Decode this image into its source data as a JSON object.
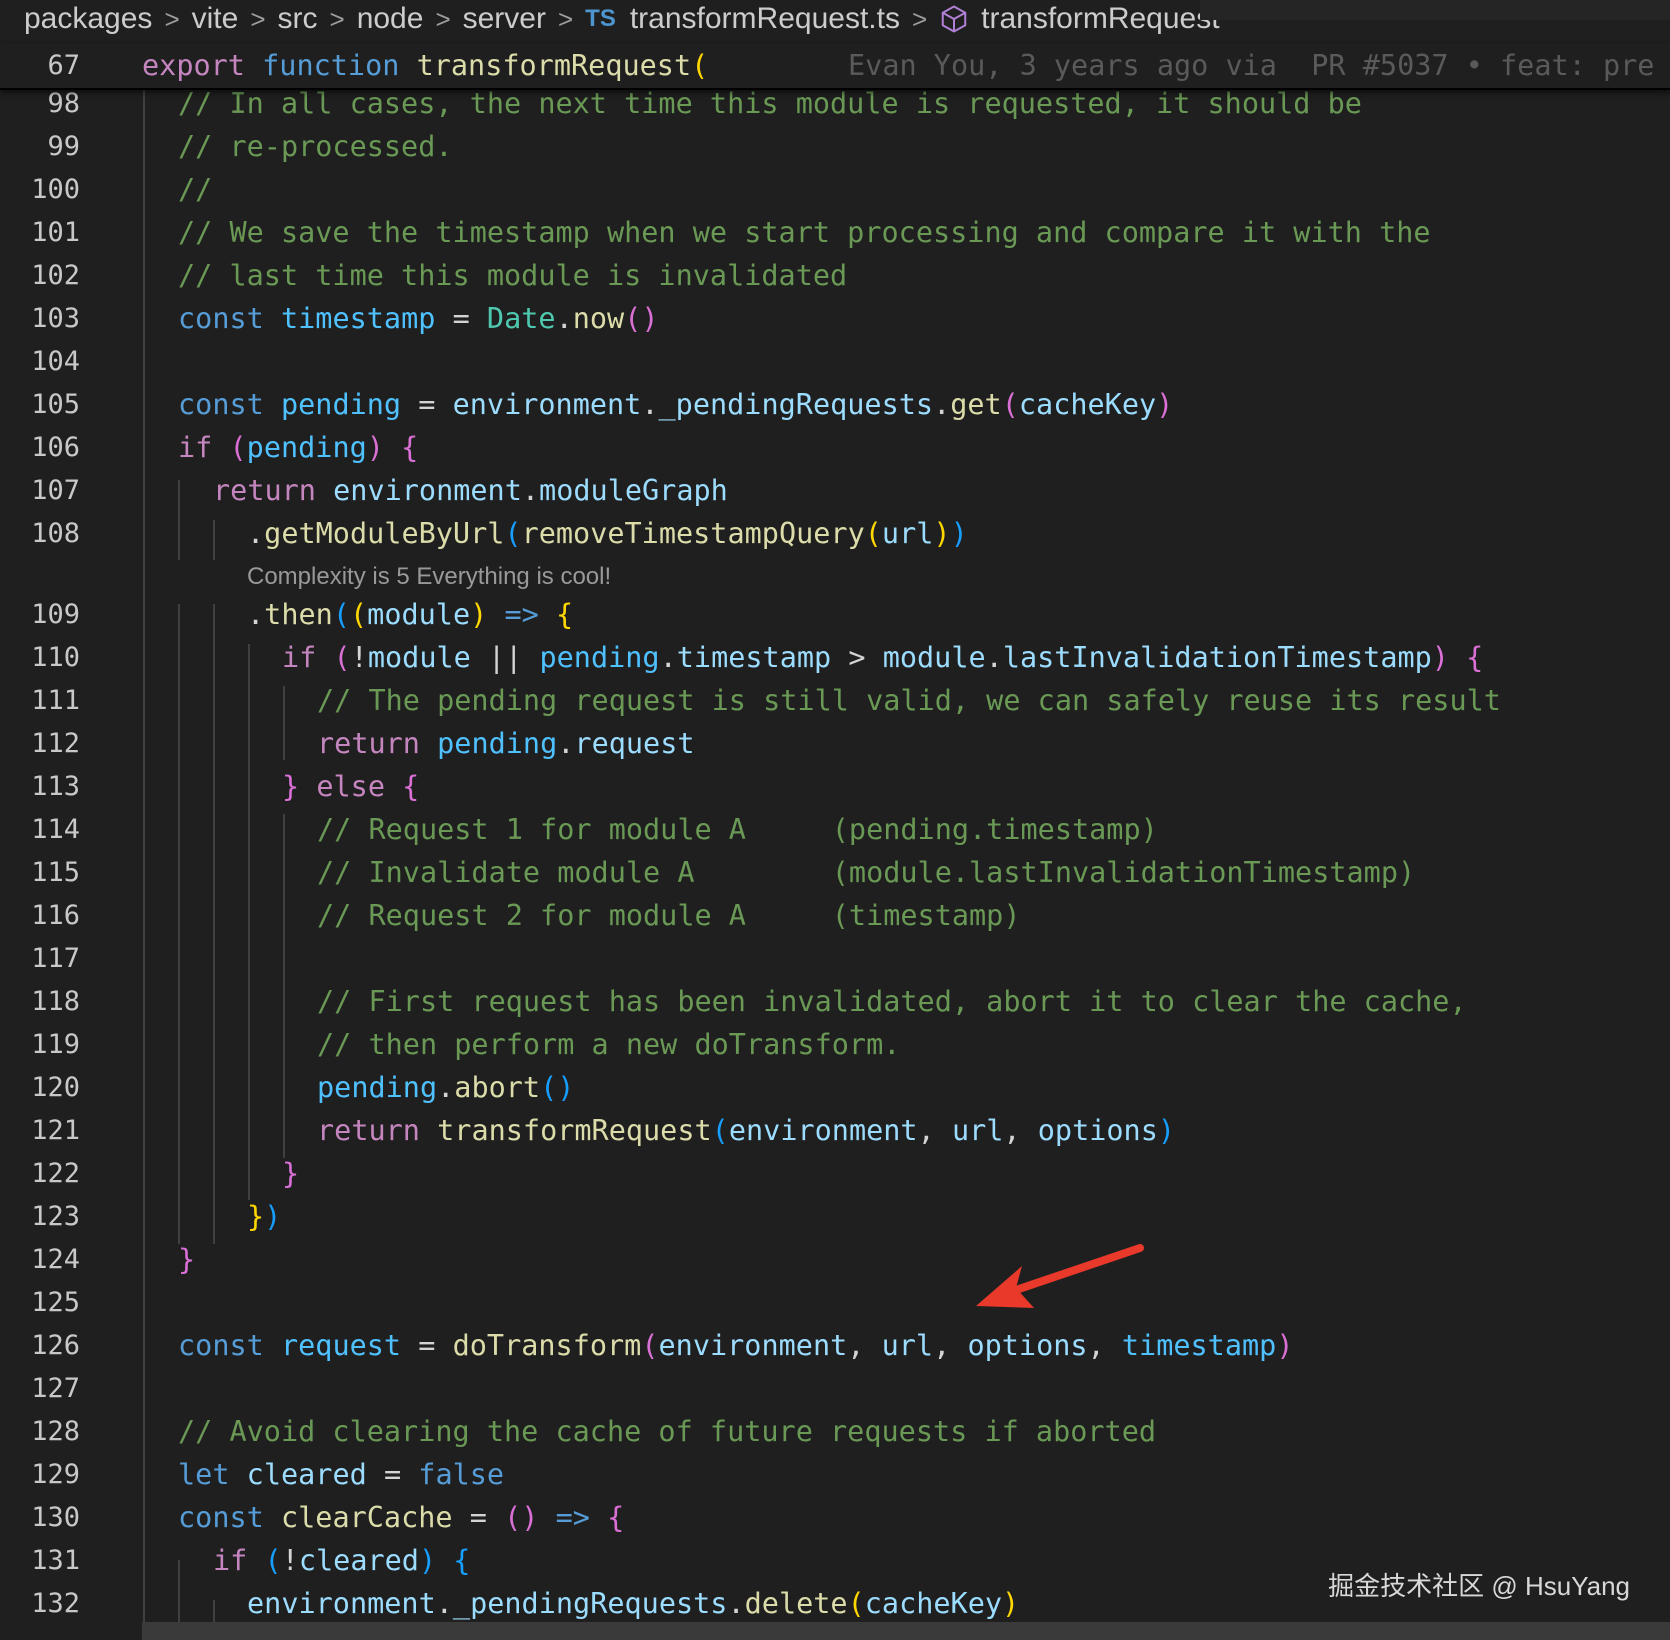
{
  "breadcrumb": {
    "segments": [
      "packages",
      "vite",
      "src",
      "node",
      "server"
    ],
    "file_lang_badge": "TS",
    "file_name": "transformRequest.ts",
    "symbol_name": "transformRequest"
  },
  "sticky": {
    "line_number": "67",
    "code": {
      "export": "export",
      "function": "function",
      "name": "transformRequest",
      "paren": "("
    },
    "blame": "Evan You, 3 years ago via  PR #5037 • feat: pre"
  },
  "code_lens": "Complexity is 5 Everything is cool!",
  "watermark": "掘金技术社区 @ HsuYang",
  "lines": {
    "l98": {
      "n": "98",
      "t": "// In all cases, the next time this module is requested, it should be"
    },
    "l99": {
      "n": "99",
      "t": "// re-processed."
    },
    "l100": {
      "n": "100",
      "t": "//"
    },
    "l101": {
      "n": "101",
      "t": "// We save the timestamp when we start processing and compare it with the"
    },
    "l102": {
      "n": "102",
      "t": "// last time this module is invalidated"
    },
    "l103": {
      "n": "103"
    },
    "l104": {
      "n": "104"
    },
    "l105": {
      "n": "105"
    },
    "l106": {
      "n": "106"
    },
    "l107": {
      "n": "107"
    },
    "l108": {
      "n": "108"
    },
    "l109": {
      "n": "109"
    },
    "l110": {
      "n": "110"
    },
    "l111": {
      "n": "111",
      "t": "// The pending request is still valid, we can safely reuse its result"
    },
    "l112": {
      "n": "112"
    },
    "l113": {
      "n": "113"
    },
    "l114": {
      "n": "114",
      "t": "// Request 1 for module A     (pending.timestamp)"
    },
    "l115": {
      "n": "115",
      "t": "// Invalidate module A        (module.lastInvalidationTimestamp)"
    },
    "l116": {
      "n": "116",
      "t": "// Request 2 for module A     (timestamp)"
    },
    "l117": {
      "n": "117"
    },
    "l118": {
      "n": "118",
      "t": "// First request has been invalidated, abort it to clear the cache,"
    },
    "l119": {
      "n": "119",
      "t": "// then perform a new doTransform."
    },
    "l120": {
      "n": "120"
    },
    "l121": {
      "n": "121"
    },
    "l122": {
      "n": "122"
    },
    "l123": {
      "n": "123"
    },
    "l124": {
      "n": "124"
    },
    "l125": {
      "n": "125"
    },
    "l126": {
      "n": "126"
    },
    "l127": {
      "n": "127"
    },
    "l128": {
      "n": "128",
      "t": "// Avoid clearing the cache of future requests if aborted"
    },
    "l129": {
      "n": "129"
    },
    "l130": {
      "n": "130"
    },
    "l131": {
      "n": "131"
    },
    "l132": {
      "n": "132"
    }
  },
  "tok": {
    "const": "const",
    "let": "let",
    "if": "if",
    "return": "return",
    "else": "else",
    "false": "false",
    "timestamp": "timestamp",
    "Date": "Date",
    "now": "now",
    "pending": "pending",
    "environment": "environment",
    "_pendingRequests": "_pendingRequests",
    "get": "get",
    "cacheKey": "cacheKey",
    "moduleGraph": "moduleGraph",
    "getModuleByUrl": "getModuleByUrl",
    "removeTimestampQuery": "removeTimestampQuery",
    "url": "url",
    "then": "then",
    "module": "module",
    "lastInvalidationTimestamp": "lastInvalidationTimestamp",
    "request": "request",
    "abort": "abort",
    "transformRequest": "transformRequest",
    "options": "options",
    "doTransform": "doTransform",
    "cleared": "cleared",
    "clearCache": "clearCache",
    "delete": "delete"
  }
}
